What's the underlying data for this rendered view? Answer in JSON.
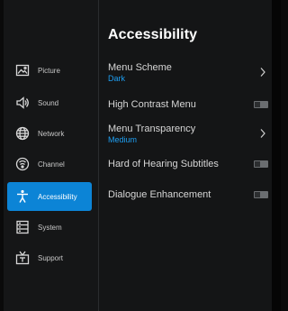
{
  "sidebar": {
    "items": [
      {
        "label": "Picture",
        "icon": "picture-icon"
      },
      {
        "label": "Sound",
        "icon": "sound-icon"
      },
      {
        "label": "Network",
        "icon": "network-icon"
      },
      {
        "label": "Channel",
        "icon": "channel-icon"
      },
      {
        "label": "Accessibility",
        "icon": "accessibility-icon",
        "selected": true
      },
      {
        "label": "System",
        "icon": "system-icon"
      },
      {
        "label": "Support",
        "icon": "support-icon"
      }
    ]
  },
  "main": {
    "title": "Accessibility",
    "settings": [
      {
        "label": "Menu Scheme",
        "value": "Dark",
        "control": "submenu"
      },
      {
        "label": "High Contrast Menu",
        "control": "toggle",
        "state": "off"
      },
      {
        "label": "Menu Transparency",
        "value": "Medium",
        "control": "submenu"
      },
      {
        "label": "Hard of Hearing Subtitles",
        "control": "toggle",
        "state": "off"
      },
      {
        "label": "Dialogue Enhancement",
        "control": "toggle",
        "state": "off"
      }
    ]
  },
  "colors": {
    "accent": "#0c84d6",
    "value_text": "#1e9ff2",
    "background": "#141516"
  }
}
